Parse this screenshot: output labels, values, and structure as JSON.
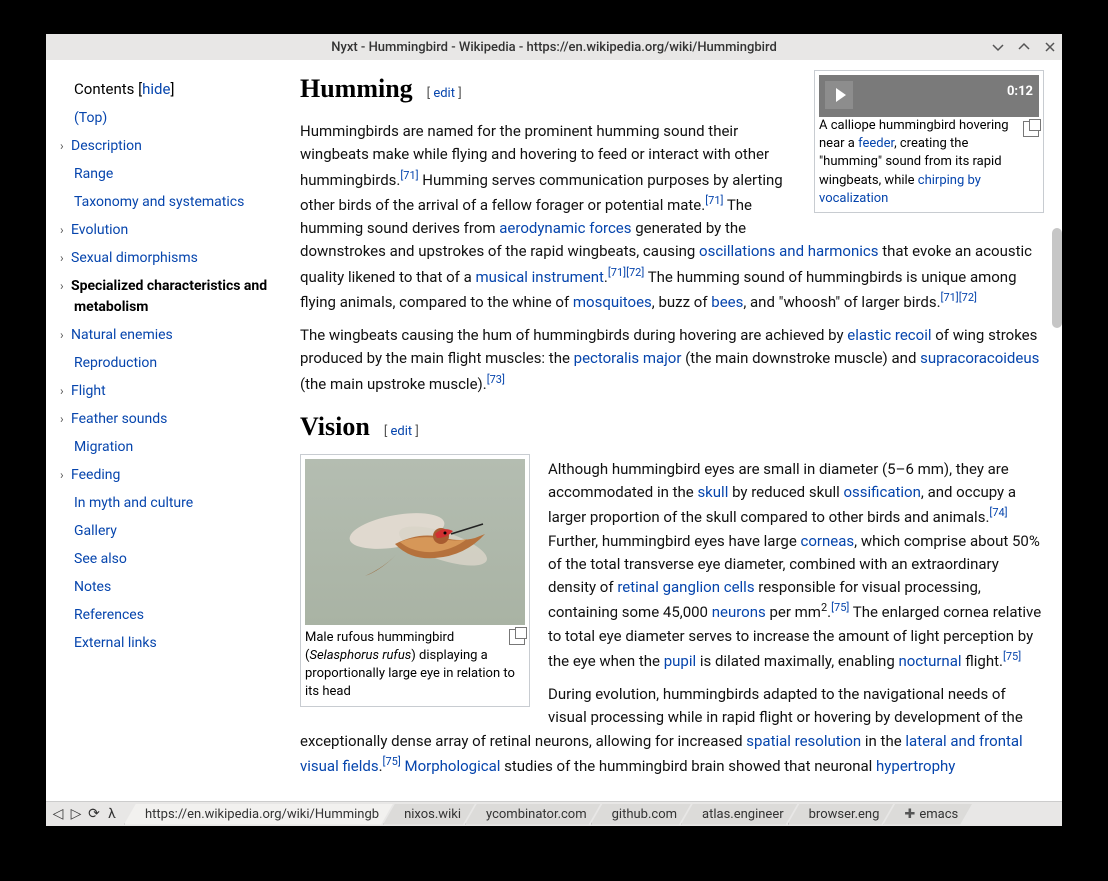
{
  "window_title": "Nyxt - Hummingbird - Wikipedia - https://en.wikipedia.org/wiki/Hummingbird",
  "toc": {
    "heading": "Contents",
    "toggle": "hide",
    "items": [
      {
        "label": "(Top)",
        "expandable": false
      },
      {
        "label": "Description",
        "expandable": true
      },
      {
        "label": "Range",
        "expandable": false
      },
      {
        "label": "Taxonomy and systematics",
        "expandable": false
      },
      {
        "label": "Evolution",
        "expandable": true
      },
      {
        "label": "Sexual dimorphisms",
        "expandable": true
      },
      {
        "label": "Specialized characteristics and metabolism",
        "expandable": true,
        "active": true
      },
      {
        "label": "Natural enemies",
        "expandable": true
      },
      {
        "label": "Reproduction",
        "expandable": false
      },
      {
        "label": "Flight",
        "expandable": true
      },
      {
        "label": "Feather sounds",
        "expandable": true
      },
      {
        "label": "Migration",
        "expandable": false
      },
      {
        "label": "Feeding",
        "expandable": true
      },
      {
        "label": "In myth and culture",
        "expandable": false
      },
      {
        "label": "Gallery",
        "expandable": false
      },
      {
        "label": "See also",
        "expandable": false
      },
      {
        "label": "Notes",
        "expandable": false
      },
      {
        "label": "References",
        "expandable": false
      },
      {
        "label": "External links",
        "expandable": false
      }
    ]
  },
  "sections": {
    "humming": {
      "title": "Humming",
      "edit": "edit",
      "video": {
        "duration": "0:12",
        "caption_prefix": "A calliope hummingbird hovering near a ",
        "link1": "feeder",
        "caption_mid": ", creating the \"humming\" sound from its rapid wingbeats, while ",
        "link2": "chirping by vocalization"
      },
      "p1": {
        "t1": "Hummingbirds are named for the prominent humming sound their wingbeats make while flying and hovering to feed or interact with other hummingbirds.",
        "ref1": "[71]",
        "t2": " Humming serves communication purposes by alerting other birds of the arrival of a fellow forager or potential mate.",
        "ref2": "[71]",
        "t3": " The humming sound derives from ",
        "link_aero": "aerodynamic forces",
        "t4": " generated by the downstrokes and upstrokes of the rapid wingbeats, causing ",
        "link_osc": "oscillations and harmonics",
        "t5": " that evoke an acoustic quality likened to that of a ",
        "link_music": "musical instrument",
        "t6": ".",
        "ref3": "[71]",
        "ref4": "[72]",
        "t7": " The humming sound of hummingbirds is unique among flying animals, compared to the whine of ",
        "link_mosq": "mosquitoes",
        "t8": ", buzz of ",
        "link_bees": "bees",
        "t9": ", and \"whoosh\" of larger birds.",
        "ref5": "[71]",
        "ref6": "[72]"
      },
      "p2": {
        "t1": "The wingbeats causing the hum of hummingbirds during hovering are achieved by ",
        "link_er": "elastic recoil",
        "t2": " of wing strokes produced by the main flight muscles: the ",
        "link_pm": "pectoralis major",
        "t3": " (the main downstroke muscle) and ",
        "link_sc": "supracoracoideus",
        "t4": " (the main upstroke muscle).",
        "ref": "[73]"
      }
    },
    "vision": {
      "title": "Vision",
      "edit": "edit",
      "fig": {
        "cap1": "Male rufous hummingbird (",
        "sci": "Selasphorus rufus",
        "cap2": ") displaying a proportionally large eye in relation to its head"
      },
      "p1": {
        "t1": "Although hummingbird eyes are small in diameter (5–6 mm), they are accommodated in the ",
        "link_skull": "skull",
        "t2": " by reduced skull ",
        "link_oss": "ossification",
        "t3": ", and occupy a larger proportion of the skull compared to other birds and animals.",
        "ref1": "[74]",
        "t4": " Further, hummingbird eyes have large ",
        "link_corneas": "corneas",
        "t5": ", which comprise about 50% of the total transverse eye diameter, combined with an extraordinary density of ",
        "link_rgc": "retinal ganglion cells",
        "t6": " responsible for visual processing, containing some 45,000 ",
        "link_neurons": "neurons",
        "t7": " per mm",
        "sup2": "2",
        "t8": ".",
        "ref2": "[75]",
        "t9": " The enlarged cornea relative to total eye diameter serves to increase the amount of light perception by the eye when the ",
        "link_pupil": "pupil",
        "t10": " is dilated maximally, enabling ",
        "link_noct": "nocturnal",
        "t11": " flight.",
        "ref3": "[75]"
      },
      "p2": {
        "t1": "During evolution, hummingbirds adapted to the navigational needs of visual processing while in rapid flight or hovering by development of the exceptionally dense array of retinal neurons, allowing for increased ",
        "link_sr": "spatial resolution",
        "t2": " in the ",
        "link_lfvf": "lateral and frontal visual fields",
        "t3": ".",
        "ref": "[75]",
        "t4": " ",
        "link_morph": "Morphological",
        "t5": " studies of the hummingbird brain showed that neuronal ",
        "link_hyper": "hypertrophy"
      }
    }
  },
  "tabs": [
    {
      "label": "https://en.wikipedia.org/wiki/Hummingb",
      "current": true
    },
    {
      "label": "nixos.wiki"
    },
    {
      "label": "ycombinator.com"
    },
    {
      "label": "github.com"
    },
    {
      "label": "atlas.engineer"
    },
    {
      "label": "browser.eng"
    },
    {
      "label": "emacs",
      "starred": true
    }
  ]
}
